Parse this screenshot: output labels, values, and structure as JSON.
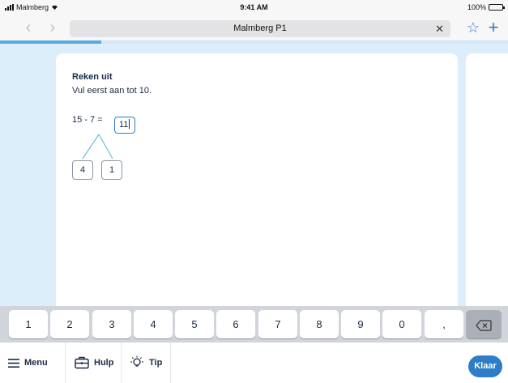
{
  "status_bar": {
    "carrier": "Malmberg",
    "time": "9:41 AM",
    "battery": "100%",
    "battery_level": 1.0
  },
  "browser": {
    "address": "Malmberg P1",
    "back_icon": "chevron-left-icon",
    "forward_icon": "chevron-right-icon",
    "clear_icon": "close-icon",
    "bookmark_icon": "star-icon",
    "new_tab_icon": "plus-icon"
  },
  "progress": {
    "fraction": 0.2
  },
  "exercise": {
    "title": "Reken uit",
    "instruction": "Vul eerst aan tot 10.",
    "equation": "15 - 7 =",
    "answer": "11",
    "split_left": "4",
    "split_right": "1"
  },
  "keyboard": {
    "keys": [
      "1",
      "2",
      "3",
      "4",
      "5",
      "6",
      "7",
      "8",
      "9",
      "0",
      ","
    ],
    "backspace_icon": "backspace-icon"
  },
  "bottom_bar": {
    "menu_label": "Menu",
    "help_label": "Hulp",
    "tip_label": "Tip",
    "done_label": "Klaar"
  },
  "colors": {
    "accent": "#2d7dc7",
    "content_bg": "#dbeefa",
    "progress": "#5aa9e3"
  }
}
